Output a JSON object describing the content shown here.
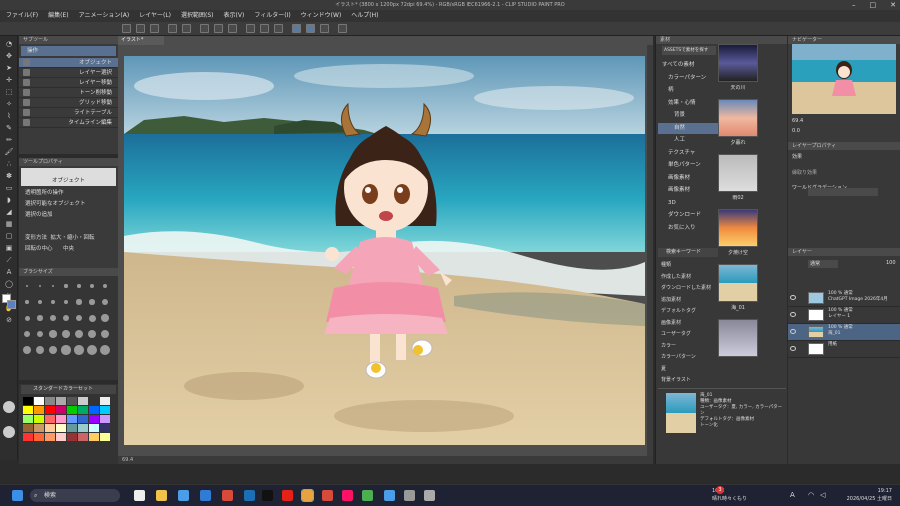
{
  "window": {
    "title": "イラスト* (3800 x 1200px 72dpi 69.4%)  -  RGB/sRGB IEC61966-2.1  -  CLIP STUDIO PAINT PRO"
  },
  "menu": [
    "ファイル(F)",
    "編集(E)",
    "アニメーション(A)",
    "レイヤー(L)",
    "選択範囲(S)",
    "表示(V)",
    "フィルター(I)",
    "ウィンドウ(W)",
    "ヘルプ(H)"
  ],
  "subtool": {
    "header": "サブツール",
    "group": "操作",
    "items": [
      "オブジェクト",
      "レイヤー選択",
      "レイヤー移動",
      "トーン削移動",
      "グリッド移動",
      "ライトテーブル",
      "タイムライン編集"
    ]
  },
  "toolprop": {
    "header": "ツールプロパティ",
    "tool_name": "オブジェクト",
    "rows": [
      "透明箇所の操作",
      "選択可能なオブジェクト",
      "選択の追加",
      "変形方法",
      "回転の中心"
    ],
    "values": [
      "",
      "",
      "",
      "拡大・縮小・回転",
      "中央"
    ]
  },
  "brushsize": {
    "header": "ブラシサイズ"
  },
  "colorset": {
    "header": "カラーセット",
    "set": "スタンダードカラーセット"
  },
  "canvas": {
    "tab": "イラスト*",
    "zoom": "69.4"
  },
  "material": {
    "header": "素材",
    "search": "ASSETSで素材を探す",
    "tree": [
      "すべての素材",
      "カラーパターン",
      "柄",
      "効果・心情",
      "背景",
      "自然",
      "人工",
      "テクスチャ",
      "単色パターン",
      "画像素材",
      "画像素材",
      "3D",
      "ダウンロード",
      "お気に入り"
    ],
    "search_panel": "検索キーワード",
    "keywords": [
      "種類",
      "作成した素材",
      "ダウンロードした素材",
      "追加素材",
      "デフォルトタグ",
      "画像素材",
      "ユーザータグ",
      "カラー",
      "カラーパターン",
      "夏",
      "背景イラスト"
    ],
    "thumbs": [
      "天の川",
      "夕暮れ",
      "雨02",
      "夕焼け空",
      "海_01",
      ""
    ],
    "detail": {
      "name": "海_01",
      "type": "種類：画像素材",
      "usertag": "ユーザータグ：夏, カラー, カラーパターン",
      "deftag": "デフォルトタグ：画像素材",
      "tone": "トーン化"
    }
  },
  "navigator": {
    "header": "ナビゲーター",
    "zoom": "69.4",
    "angle": "0.0"
  },
  "layerprop": {
    "header": "レイヤープロパティ",
    "effect": "効果",
    "border": "縁取り効果",
    "sub": "ワールドグラデーション"
  },
  "layers": {
    "header": "レイヤー",
    "blend": "通常",
    "opacity": "100",
    "items": [
      {
        "line1": "100 % 通常",
        "line2": "ChatGPT Image 2026年4月"
      },
      {
        "line1": "100 % 通常",
        "line2": "レイヤー 1"
      },
      {
        "line1": "100 % 通常",
        "line2": "海_01"
      },
      {
        "line1": "",
        "line2": "用紙"
      }
    ]
  },
  "taskbar": {
    "search": "検索",
    "weather_temp": "16°C",
    "weather_desc": "晴れ時々くもり",
    "time": "19:17",
    "date": "2026/04/25 土曜日",
    "badge": "3"
  }
}
